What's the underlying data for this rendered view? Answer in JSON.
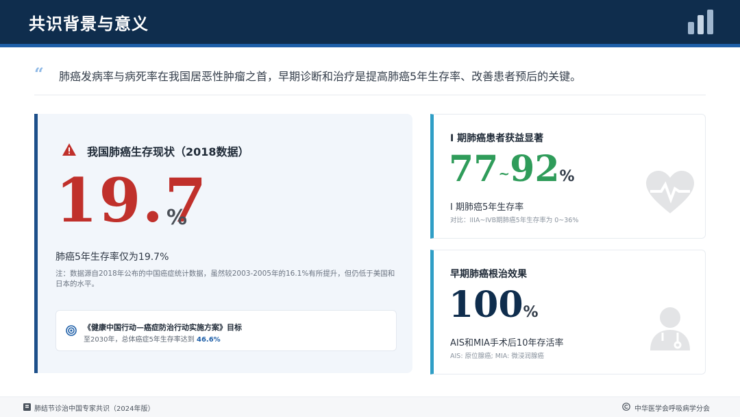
{
  "header": {
    "title": "共识背景与意义",
    "icon": "bar-chart-icon"
  },
  "quote": {
    "mark": "“",
    "text": "肺癌发病率与病死率在我国居恶性肿瘤之首，早期诊断和治疗是提高肺癌5年生存率、改善患者预后的关键。"
  },
  "left_panel": {
    "icon": "warning-icon",
    "title": "我国肺癌生存现状（2018数据）",
    "big_value": "19.7",
    "big_unit": "%",
    "caption": "肺癌5年生存率仅为19.7%",
    "note": "注：数据源自2018年公布的中国癌症统计数据，虽然较2003-2005年的16.1%有所提升，但仍低于美国和日本的水平。",
    "goal": {
      "icon": "target-icon",
      "title": "《健康中国行动—癌症防治行动实施方案》目标",
      "desc_prefix": "至2030年，总体癌症5年生存率达到 ",
      "desc_value": "46.6%"
    }
  },
  "right_cards": [
    {
      "title": "Ⅰ 期肺癌患者获益显著",
      "value_low": "77",
      "tilde": "~",
      "value_high": "92",
      "unit": "%",
      "caption": "Ⅰ 期肺癌5年生存率",
      "note": "对比：IIIA~IVB期肺癌5年生存率为 0~36%",
      "watermark": "heart-pulse-icon",
      "accent": "#2f9c5a"
    },
    {
      "title": "早期肺癌根治效果",
      "value": "100",
      "unit": "%",
      "caption": "AIS和MIA手术后10年存活率",
      "note": "AIS: 原位腺癌; MIA: 微浸润腺癌",
      "watermark": "doctor-icon",
      "accent": "#0f2d4d"
    }
  ],
  "footer": {
    "left_icon": "book-icon",
    "left": "肺结节诊治中国专家共识（2024年版）",
    "right_icon": "copyright-icon",
    "right": "中华医学会呼吸病学分会"
  },
  "colors": {
    "header_bg": "#0f2d4d",
    "accent_blue": "#1e5fa8",
    "alert_red": "#c0302b",
    "success_green": "#2f9c5a",
    "card_border": "#2f9ec6"
  }
}
